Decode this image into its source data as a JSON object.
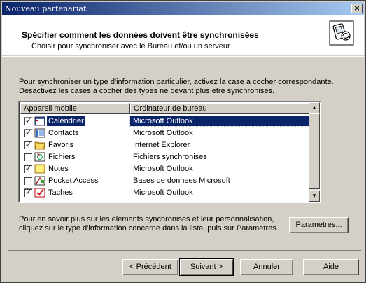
{
  "window": {
    "title": "Nouveau partenariat"
  },
  "header": {
    "title": "Spécifier comment les données doivent être synchronisées",
    "subtitle": "Choisir pour synchroniser avec le Bureau et/ou un serveur",
    "icon": "sync-devices-icon"
  },
  "intro": "Pour synchroniser un type d'information particulier, activez la case a cocher correspondante. Desactivez les cases a cocher des types ne devant plus etre synchronises.",
  "list": {
    "columns": [
      "Appareil mobile",
      "Ordinateur de bureau"
    ],
    "rows": [
      {
        "name": "Calendrier",
        "app": "Microsoft Outlook",
        "checked": true,
        "selected": true,
        "icon": "calendar-icon"
      },
      {
        "name": "Contacts",
        "app": "Microsoft Outlook",
        "checked": true,
        "selected": false,
        "icon": "contacts-icon"
      },
      {
        "name": "Favoris",
        "app": "Internet Explorer",
        "checked": true,
        "selected": false,
        "icon": "favorites-folder-icon"
      },
      {
        "name": "Fichiers",
        "app": "Fichiers synchronises",
        "checked": false,
        "selected": false,
        "icon": "files-icon"
      },
      {
        "name": "Notes",
        "app": "Microsoft Outlook",
        "checked": true,
        "selected": false,
        "icon": "notes-icon"
      },
      {
        "name": "Pocket Access",
        "app": "Bases de donnees Microsoft",
        "checked": false,
        "selected": false,
        "icon": "pocket-access-icon"
      },
      {
        "name": "Taches",
        "app": "Microsoft Outlook",
        "checked": true,
        "selected": false,
        "icon": "tasks-icon"
      }
    ]
  },
  "info": "Pour en savoir plus sur les elements synchronises et leur personnalisation, cliquez sur le type d'information concerne dans la liste, puis sur Parametres.",
  "buttons": {
    "params": "Parametres...",
    "prev": "< Précédent",
    "next": "Suivant >",
    "cancel": "Annuler",
    "help": "Aide"
  }
}
